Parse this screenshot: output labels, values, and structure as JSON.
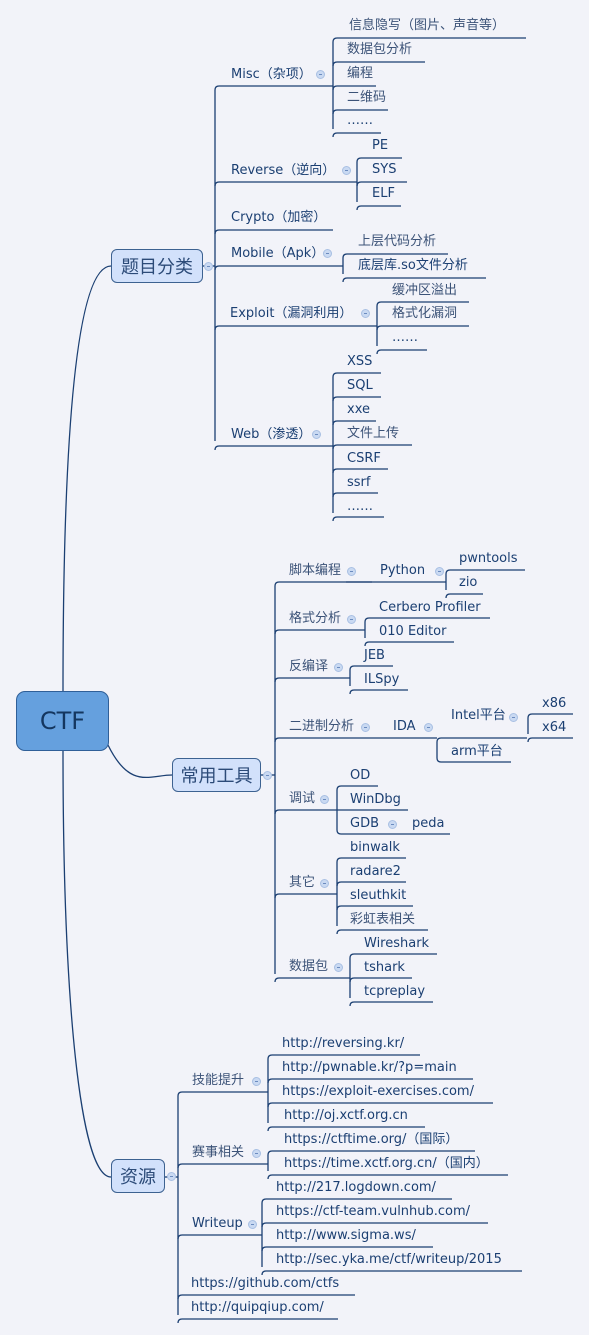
{
  "root": {
    "label": "CTF"
  },
  "branches": [
    {
      "label": "题目分类",
      "children": [
        {
          "label": "Misc（杂项）",
          "children": [
            "信息隐写（图片、声音等）",
            "数据包分析",
            "编程",
            "二维码",
            "……"
          ]
        },
        {
          "label": "Reverse（逆向）",
          "children": [
            "PE",
            "SYS",
            "ELF"
          ]
        },
        {
          "label": "Crypto（加密）",
          "children": []
        },
        {
          "label": "Mobile（Apk）",
          "children": [
            "上层代码分析",
            "底层库.so文件分析"
          ]
        },
        {
          "label": "Exploit（漏洞利用）",
          "children": [
            "缓冲区溢出",
            "格式化漏洞",
            "……"
          ]
        },
        {
          "label": "Web（渗透）",
          "children": [
            "XSS",
            "SQL",
            "xxe",
            "文件上传",
            "CSRF",
            "ssrf",
            "……"
          ]
        }
      ]
    },
    {
      "label": "常用工具",
      "children": [
        {
          "label": "脚本编程",
          "children": [
            {
              "label": "Python",
              "children": [
                "pwntools",
                "zio"
              ]
            }
          ]
        },
        {
          "label": "格式分析",
          "children": [
            "Cerbero Profiler",
            "010 Editor"
          ]
        },
        {
          "label": "反编译",
          "children": [
            "JEB",
            "ILSpy"
          ]
        },
        {
          "label": "二进制分析",
          "children": [
            {
              "label": "IDA",
              "children": [
                {
                  "label": "Intel平台",
                  "children": [
                    "x86",
                    "x64"
                  ]
                },
                "arm平台"
              ]
            }
          ]
        },
        {
          "label": "调试",
          "children": [
            "OD",
            "WinDbg",
            {
              "label": "GDB",
              "children": [
                "peda"
              ]
            }
          ]
        },
        {
          "label": "其它",
          "children": [
            "binwalk",
            "radare2",
            "sleuthkit",
            "彩虹表相关"
          ]
        },
        {
          "label": "数据包",
          "children": [
            "Wireshark",
            "tshark",
            "tcpreplay"
          ]
        }
      ]
    },
    {
      "label": "资源",
      "children": [
        {
          "label": "技能提升",
          "children": [
            "http://reversing.kr/",
            "http://pwnable.kr/?p=main",
            "https://exploit-exercises.com/",
            "http://oj.xctf.org.cn"
          ]
        },
        {
          "label": "赛事相关",
          "children": [
            "https://ctftime.org/（国际）",
            "https://time.xctf.org.cn/（国内）"
          ]
        },
        {
          "label": "Writeup",
          "children": [
            "http://217.logdown.com/",
            "https://ctf-team.vulnhub.com/",
            "http://www.sigma.ws/",
            "http://sec.yka.me/ctf/writeup/2015"
          ]
        },
        {
          "label": "https://github.com/ctfs",
          "children": []
        },
        {
          "label": "http://quipqiup.com/",
          "children": []
        }
      ]
    }
  ],
  "colors": {
    "line": "#1b3f72",
    "root_fill": "#65a0de",
    "main_fill": "#d2e1fb",
    "background": "#f2f3f9"
  }
}
